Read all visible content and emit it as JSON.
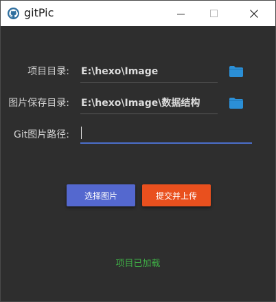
{
  "window": {
    "title": "gitPic",
    "icon": "github-octocat-icon"
  },
  "form": {
    "project_dir": {
      "label": "项目目录:",
      "value": "E:\\hexo\\Image"
    },
    "save_dir": {
      "label": "图片保存目录:",
      "value": "E:\\hexo\\Image\\数据结构"
    },
    "git_path": {
      "label": "Git图片路径:",
      "value": "",
      "placeholder": ""
    }
  },
  "buttons": {
    "select_label": "选择图片",
    "upload_label": "提交并上传"
  },
  "status": {
    "text": "项目已加载"
  },
  "colors": {
    "background": "#2e2e2e",
    "accent_blue": "#5468cf",
    "accent_orange": "#e9501e",
    "folder_blue": "#2b8fd6",
    "status_green": "#3fae46",
    "input_focus": "#4c6fcc"
  }
}
